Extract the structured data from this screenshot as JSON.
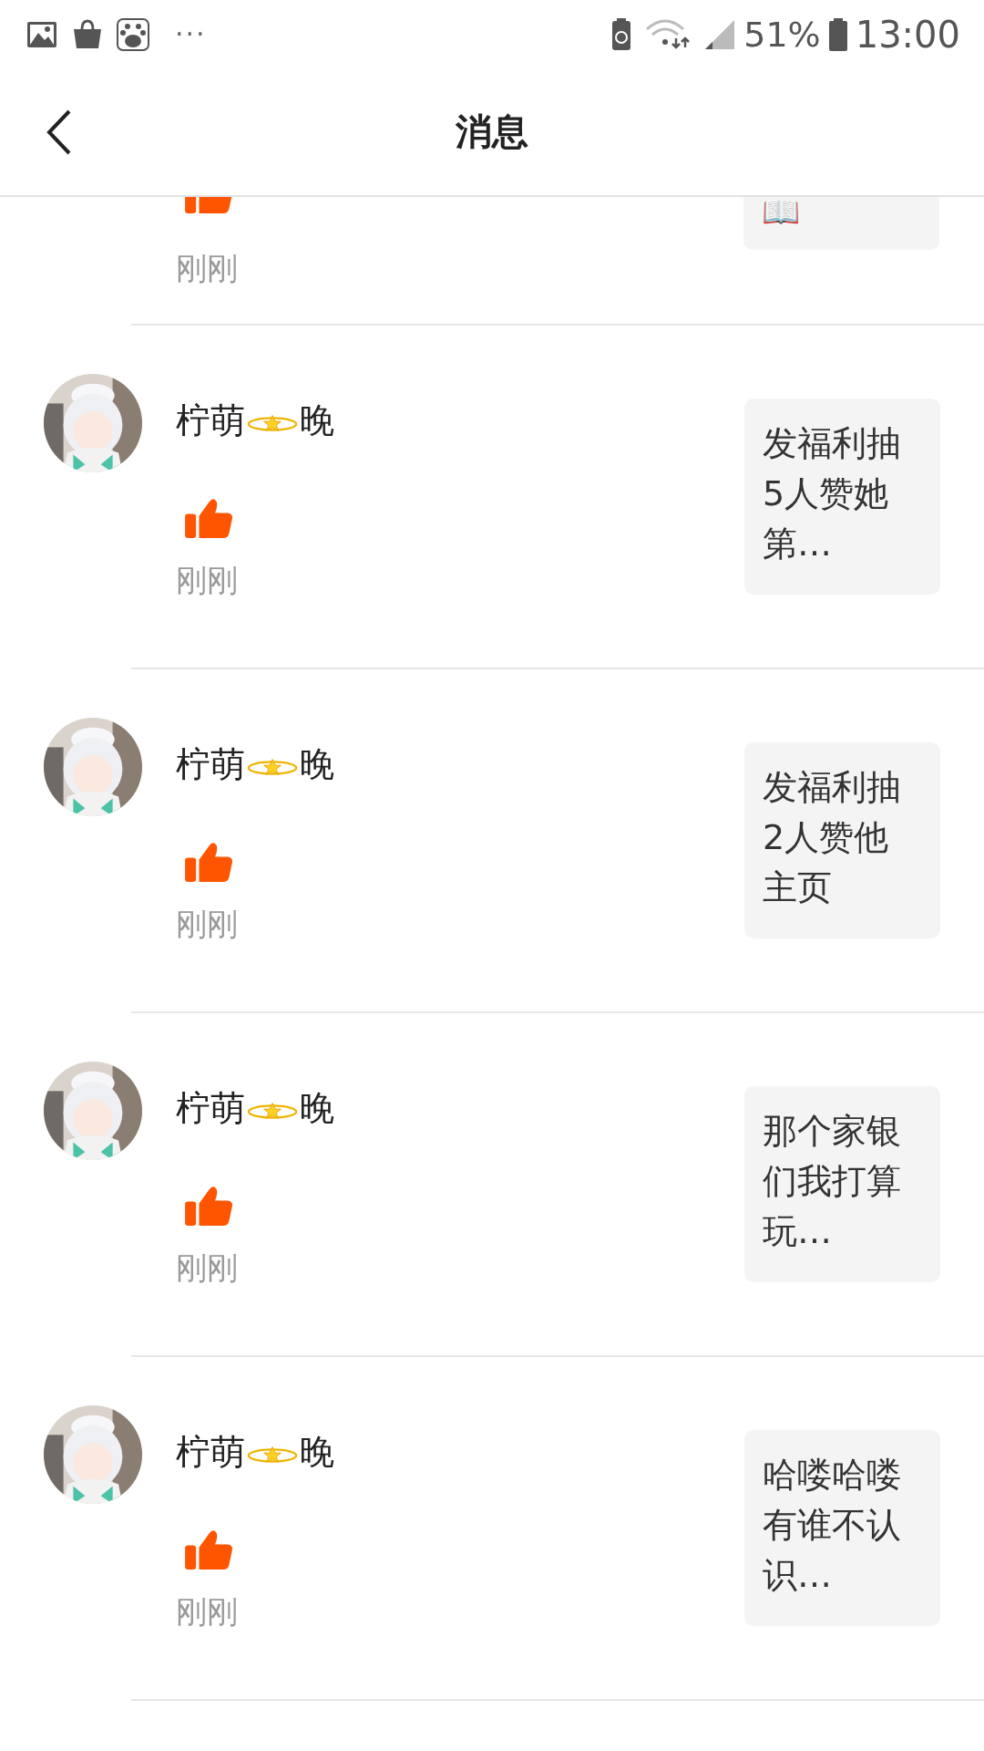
{
  "status_bar": {
    "battery_percent": "51%",
    "time": "13:00",
    "more": "···"
  },
  "header": {
    "title": "消息"
  },
  "partial_item": {
    "time": "刚刚",
    "preview": "📖"
  },
  "messages": [
    {
      "name_before_icon": "柠萌",
      "name_after_icon": "晚",
      "time": "刚刚",
      "preview": "发福利抽5人赞她第…"
    },
    {
      "name_before_icon": "柠萌",
      "name_after_icon": "晚",
      "time": "刚刚",
      "preview": "发福利抽2人赞他主页"
    },
    {
      "name_before_icon": "柠萌",
      "name_after_icon": "晚",
      "time": "刚刚",
      "preview": "那个家银们我打算玩…"
    },
    {
      "name_before_icon": "柠萌",
      "name_after_icon": "晚",
      "time": "刚刚",
      "preview": "哈喽哈喽有谁不认识…"
    }
  ]
}
